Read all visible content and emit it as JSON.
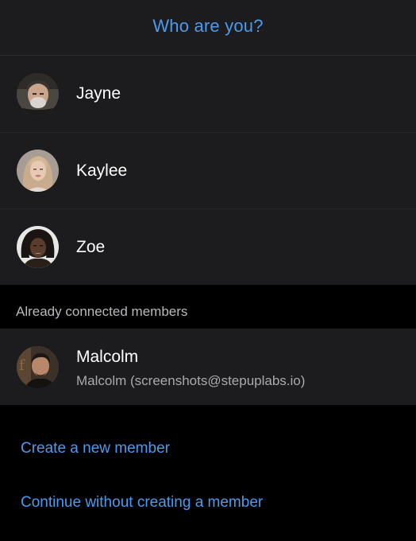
{
  "header": {
    "title": "Who are you?"
  },
  "members": [
    {
      "name": "Jayne",
      "avatar_icon": "avatar-photo-jayne"
    },
    {
      "name": "Kaylee",
      "avatar_icon": "avatar-photo-kaylee"
    },
    {
      "name": "Zoe",
      "avatar_icon": "avatar-photo-zoe"
    }
  ],
  "connected_section": {
    "title": "Already connected members",
    "members": [
      {
        "name": "Malcolm",
        "detail": "Malcolm (screenshots@stepuplabs.io)",
        "avatar_icon": "avatar-photo-malcolm"
      }
    ]
  },
  "actions": {
    "create_label": "Create a new member",
    "continue_label": "Continue without creating a member"
  },
  "colors": {
    "accent": "#4a9bf0",
    "row_background": "#1c1c1e",
    "page_background": "#000000"
  }
}
